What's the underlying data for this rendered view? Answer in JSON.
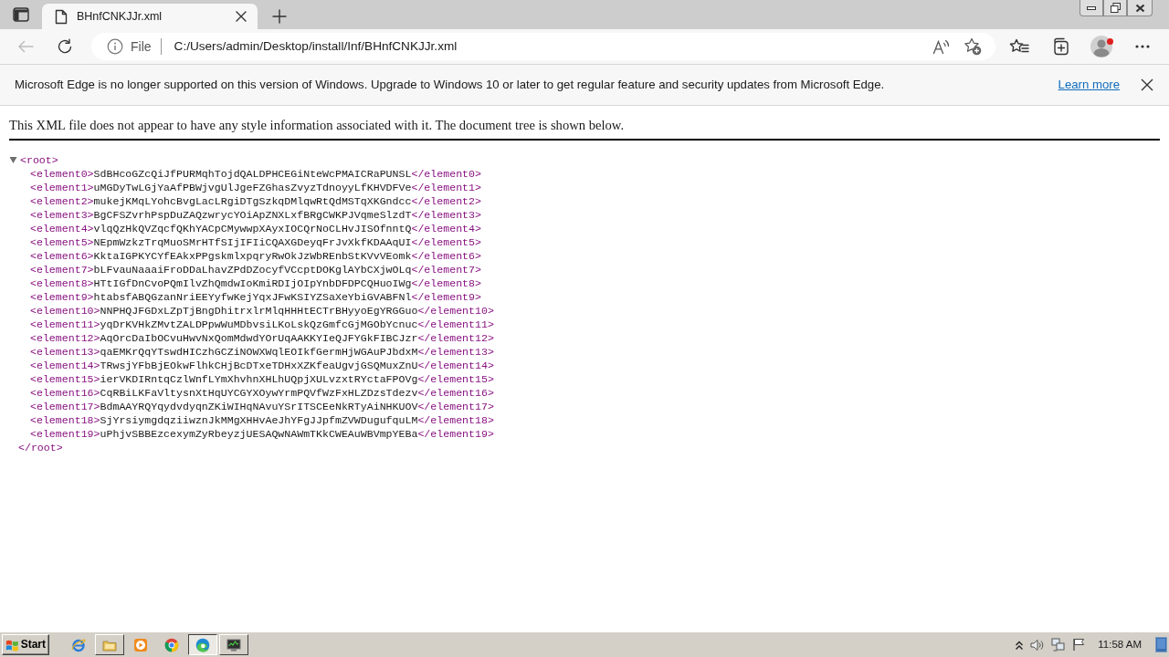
{
  "tabs": [
    {
      "title": "BHnfCNKJJr.xml",
      "selected": true
    }
  ],
  "toolbar": {
    "back_button": {
      "disabled": true
    },
    "site_label": "File",
    "url": "C:/Users/admin/Desktop/install/Inf/BHnfCNKJJr.xml"
  },
  "infobar": {
    "message": "Microsoft Edge is no longer supported on this version of Windows. Upgrade to Windows 10 or later to get regular feature and security updates from Microsoft Edge.",
    "link": "Learn more"
  },
  "page": {
    "notice": "This XML file does not appear to have any style information associated with it. The document tree is shown below.",
    "tree": {
      "open_tag": "<root>",
      "close_tag": "</root>",
      "expanded": true,
      "children": [
        {
          "open_tag": "<element0>",
          "text": "SdBHcoGZcQiJfPURMqhTojdQALDPHCEGiNteWcPMAICRaPUNSL",
          "close_tag": "</element0>"
        },
        {
          "open_tag": "<element1>",
          "text": "uMGDyTwLGjYaAfPBWjvgUlJgeFZGhasZvyzTdnoyyLfKHVDFVe",
          "close_tag": "</element1>"
        },
        {
          "open_tag": "<element2>",
          "text": "mukejKMqLYohcBvgLacLRgiDTgSzkqDMlqwRtQdMSTqXKGndcc",
          "close_tag": "</element2>"
        },
        {
          "open_tag": "<element3>",
          "text": "BgCFSZvrhPspDuZAQzwrycYOiApZNXLxfBRgCWKPJVqmeSlzdT",
          "close_tag": "</element3>"
        },
        {
          "open_tag": "<element4>",
          "text": "vlqQzHkQVZqcfQKhYACpCMywwpXAyxIOCQrNoCLHvJISOfnntQ",
          "close_tag": "</element4>"
        },
        {
          "open_tag": "<element5>",
          "text": "NEpmWzkzTrqMuoSMrHTfSIjIFIiCQAXGDeyqFrJvXkfKDAAqUI",
          "close_tag": "</element5>"
        },
        {
          "open_tag": "<element6>",
          "text": "KktaIGPKYCYfEAkxPPgskmlxpqryRwOkJzWbREnbStKVvVEomk",
          "close_tag": "</element6>"
        },
        {
          "open_tag": "<element7>",
          "text": "bLFvauNaaaiFroDDaLhavZPdDZocyfVCcptDOKglAYbCXjwOLq",
          "close_tag": "</element7>"
        },
        {
          "open_tag": "<element8>",
          "text": "HTtIGfDnCvoPQmIlvZhQmdwIoKmiRDIjOIpYnbDFDPCQHuoIWg",
          "close_tag": "</element8>"
        },
        {
          "open_tag": "<element9>",
          "text": "htabsfABQGzanNriEEYyfwKejYqxJFwKSIYZSaXeYbiGVABFNl",
          "close_tag": "</element9>"
        },
        {
          "open_tag": "<element10>",
          "text": "NNPHQJFGDxLZpTjBngDhitrxlrMlqHHHtECTrBHyyoEgYRGGuo",
          "close_tag": "</element10>"
        },
        {
          "open_tag": "<element11>",
          "text": "yqDrKVHkZMvtZALDPpwWuMDbvsiLKoLskQzGmfcGjMGObYcnuc",
          "close_tag": "</element11>"
        },
        {
          "open_tag": "<element12>",
          "text": "AqOrcDaIbOCvuHwvNxQomMdwdYOrUqAAKKYIeQJFYGkFIBCJzr",
          "close_tag": "</element12>"
        },
        {
          "open_tag": "<element13>",
          "text": "qaEMKrQqYTswdHICzhGCZiNOWXWqlEOIkfGermHjWGAuPJbdxM",
          "close_tag": "</element13>"
        },
        {
          "open_tag": "<element14>",
          "text": "TRwsjYFbBjEOkwFlhkCHjBcDTxeTDHxXZKfeaUgvjGSQMuxZnU",
          "close_tag": "</element14>"
        },
        {
          "open_tag": "<element15>",
          "text": "ierVKDIRntqCzlWnfLYmXhvhnXHLhUQpjXULvzxtRYctaFPOVg",
          "close_tag": "</element15>"
        },
        {
          "open_tag": "<element16>",
          "text": "CqRBiLKFaVltysnXtHqUYCGYXOywYrmPQVfWzFxHLZDzsTdezv",
          "close_tag": "</element16>"
        },
        {
          "open_tag": "<element17>",
          "text": "BdmAAYRQYqydvdyqnZKiWIHqNAvuYSrITSCEeNkRTyAiNHKUOV",
          "close_tag": "</element17>"
        },
        {
          "open_tag": "<element18>",
          "text": "SjYrsiymgdqziiwznJkMMgXHHvAeJhYFgJJpfmZVWDugufquLM",
          "close_tag": "</element18>"
        },
        {
          "open_tag": "<element19>",
          "text": "uPhjvSBBEzcexymZyRbeyzjUESAQwNAWmTKkCWEAuWBVmpYEBa",
          "close_tag": "</element19>"
        }
      ]
    }
  },
  "taskbar": {
    "start": "Start",
    "apps": [
      {
        "kind": "pinned",
        "selected": false
      },
      {
        "kind": "window",
        "selected": false
      },
      {
        "kind": "pinned",
        "selected": false
      },
      {
        "kind": "pinned",
        "selected": false
      },
      {
        "kind": "window",
        "selected": true
      },
      {
        "kind": "window",
        "selected": false
      }
    ],
    "clock": "11:58 AM"
  }
}
